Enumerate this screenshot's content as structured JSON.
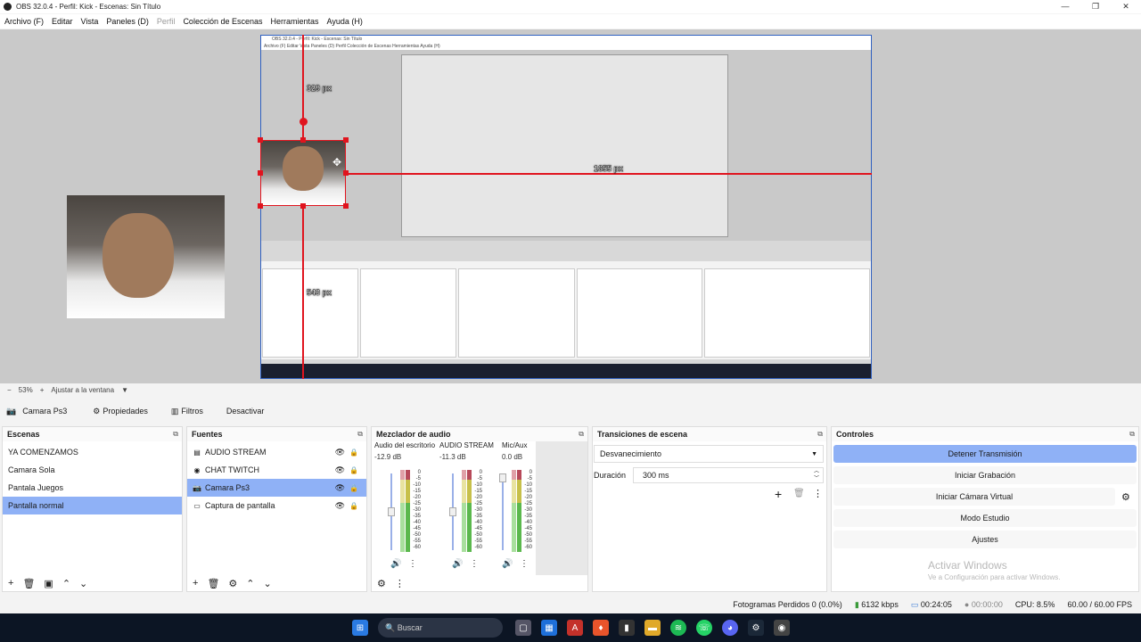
{
  "window": {
    "title": "OBS 32.0.4 - Perfil: Kick - Escenas: Sin Título",
    "minimize": "—",
    "maximize": "❐",
    "close": "✕"
  },
  "menu": [
    "Archivo (F)",
    "Editar",
    "Vista",
    "Paneles (D)",
    "Perfil",
    "Colección de Escenas",
    "Herramientas",
    "Ayuda (H)"
  ],
  "preview": {
    "inner_title": "OBS 32.0.4 - Perfil: Kick - Escenas: Sin Título",
    "inner_menu": "Archivo (F)   Editar   Vista   Paneles (D)   Perfil   Colección de Escenas   Herramientas   Ayuda (H)",
    "measure_top": "329 px",
    "measure_right": "1655 px",
    "measure_bottom": "543 px"
  },
  "zoom": {
    "minus": "−",
    "value": "53%",
    "plus": "+",
    "fit": "Ajustar a la ventana"
  },
  "source_bar": {
    "source_name": "Camara Ps3",
    "props": "Propiedades",
    "filters": "Filtros",
    "deactivate": "Desactivar"
  },
  "scenes": {
    "title": "Escenas",
    "items": [
      "YA COMENZAMOS",
      "Camara Sola",
      "Pantala Juegos",
      "Pantalla normal"
    ],
    "selected": 3
  },
  "sources": {
    "title": "Fuentes",
    "items": [
      {
        "name": "AUDIO STREAM",
        "icon": "audio-icon"
      },
      {
        "name": "CHAT TWITCH",
        "icon": "browser-icon"
      },
      {
        "name": "Camara Ps3",
        "icon": "camera-icon"
      },
      {
        "name": "Captura de pantalla",
        "icon": "monitor-icon"
      }
    ],
    "selected": 2
  },
  "mixer": {
    "title": "Mezclador de audio",
    "channels": [
      {
        "name": "Audio del escritorio",
        "db": "-12.9 dB",
        "level": 0.45
      },
      {
        "name": "AUDIO STREAM",
        "db": "-11.3 dB",
        "level": 0.45
      },
      {
        "name": "Mic/Aux",
        "db": "0.0 dB",
        "level": 0.9
      }
    ],
    "scale": [
      "0",
      "-5",
      "-10",
      "-15",
      "-20",
      "-25",
      "-30",
      "-35",
      "-40",
      "-45",
      "-50",
      "-55",
      "-60"
    ]
  },
  "transitions": {
    "title": "Transiciones de escena",
    "selected": "Desvanecimiento",
    "duration_label": "Duración",
    "duration_value": "300 ms"
  },
  "controls": {
    "title": "Controles",
    "stop_stream": "Detener Transmisión",
    "start_rec": "Iniciar Grabación",
    "start_vcam": "Iniciar Cámara Virtual",
    "studio": "Modo Estudio",
    "settings": "Ajustes"
  },
  "activate": {
    "line1": "Activar Windows",
    "line2": "Ve a Configuración para activar Windows."
  },
  "status": {
    "dropped": "Fotogramas Perdidos 0 (0.0%)",
    "kbps": "6132 kbps",
    "stream_time": "00:24:05",
    "rec_time": "00:00:00",
    "cpu": "CPU: 8.5%",
    "fps": "60.00 / 60.00 FPS"
  },
  "taskbar": {
    "search": "Buscar"
  },
  "colors": {
    "accent": "#8fb1f6",
    "red": "#e0141e"
  }
}
